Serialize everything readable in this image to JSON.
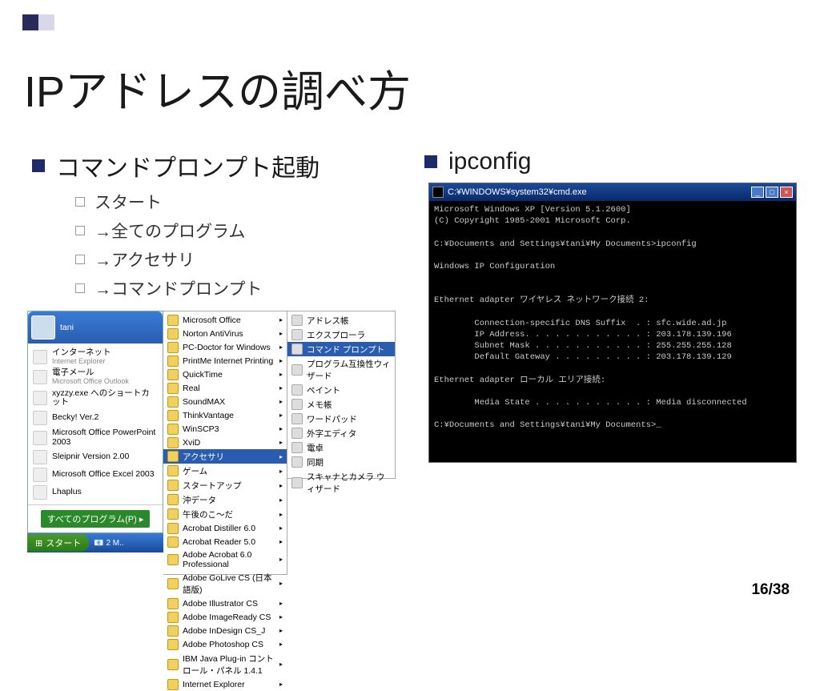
{
  "slide": {
    "title": "IPアドレスの調べ方",
    "page": "16/38"
  },
  "left": {
    "heading": "コマンドプロンプト起動",
    "steps": [
      "スタート",
      "→全てのプログラム",
      "→アクセサリ",
      "→コマンドプロンプト"
    ]
  },
  "right": {
    "heading": "ipconfig"
  },
  "startmenu": {
    "user": "tani",
    "leftItems": [
      {
        "label": "インターネット",
        "sub": "Internet Explorer",
        "ic": "ie"
      },
      {
        "label": "電子メール",
        "sub": "Microsoft Office Outlook",
        "ic": "mail"
      },
      {
        "label": "xyzzy.exe へのショートカット",
        "ic": "sc"
      },
      {
        "label": "Becky! Ver.2",
        "ic": "becky"
      },
      {
        "label": "Microsoft Office PowerPoint 2003",
        "ic": "ppt"
      },
      {
        "label": "Sleipnir Version 2.00",
        "ic": "sleipnir"
      },
      {
        "label": "Microsoft Office Excel 2003",
        "ic": "xls"
      },
      {
        "label": "Lhaplus",
        "ic": "lha"
      }
    ],
    "allPrograms": "すべてのプログラム(P)",
    "startBtn": "スタート",
    "middleItems": [
      "Microsoft Office",
      "Norton AntiVirus",
      "PC-Doctor for Windows",
      "PrintMe Internet Printing",
      "QuickTime",
      "Real",
      "SoundMAX",
      "ThinkVantage",
      "WinSCP3",
      "XviD",
      "アクセサリ",
      "ゲーム",
      "スタートアップ",
      "沖データ",
      "午後のこ～だ",
      "Acrobat Distiller 6.0",
      "Acrobat Reader 5.0",
      "Adobe Acrobat 6.0 Professional",
      "Adobe GoLive CS (日本語版)",
      "Adobe Illustrator CS",
      "Adobe ImageReady CS",
      "Adobe InDesign CS_J",
      "Adobe Photoshop CS",
      "IBM Java Plug-in コントロール・パネル 1.4.1",
      "Internet Explorer"
    ],
    "middleSelectedIndex": 10,
    "rightItems": [
      "アドレス帳",
      "エクスプローラ",
      "コマンド プロンプト",
      "プログラム互換性ウィザード",
      "ペイント",
      "メモ帳",
      "ワードパッド",
      "外字エディタ",
      "電卓",
      "同期",
      "スキャナとカメラ ウィザード"
    ],
    "rightSelectedIndex": 2
  },
  "cmd": {
    "title": "C:¥WINDOWS¥system32¥cmd.exe",
    "lines": [
      "Microsoft Windows XP [Version 5.1.2600]",
      "(C) Copyright 1985-2001 Microsoft Corp.",
      "",
      "C:¥Documents and Settings¥tani¥My Documents>ipconfig",
      "",
      "Windows IP Configuration",
      "",
      "",
      "Ethernet adapter ワイヤレス ネットワーク接続 2:",
      "",
      "        Connection-specific DNS Suffix  . : sfc.wide.ad.jp",
      "        IP Address. . . . . . . . . . . . : 203.178.139.196",
      "        Subnet Mask . . . . . . . . . . . : 255.255.255.128",
      "        Default Gateway . . . . . . . . . : 203.178.139.129",
      "",
      "Ethernet adapter ローカル エリア接続:",
      "",
      "        Media State . . . . . . . . . . . : Media disconnected",
      "",
      "C:¥Documents and Settings¥tani¥My Documents>_"
    ]
  }
}
